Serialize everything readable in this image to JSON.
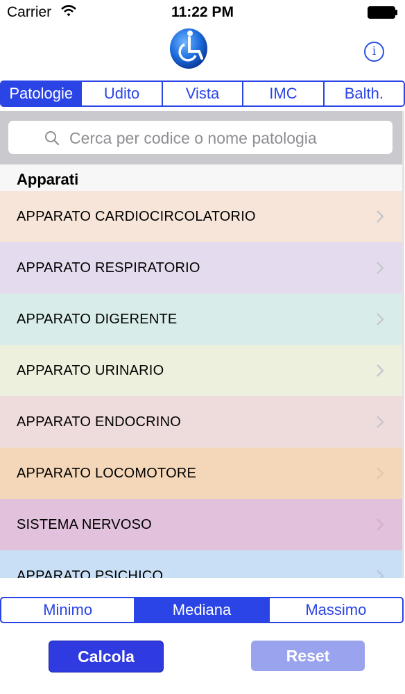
{
  "status_bar": {
    "carrier": "Carrier",
    "time": "11:22 PM"
  },
  "nav": {
    "logo_icon": "wheelchair-logo-icon",
    "info_icon": "info-icon",
    "info_glyph": "i"
  },
  "tabs": [
    {
      "label": "Patologie",
      "active": true
    },
    {
      "label": "Udito",
      "active": false
    },
    {
      "label": "Vista",
      "active": false
    },
    {
      "label": "IMC",
      "active": false
    },
    {
      "label": "Balth.",
      "active": false
    }
  ],
  "search": {
    "placeholder": "Cerca per codice o nome patologia"
  },
  "list": {
    "section_title": "Apparati",
    "items": [
      {
        "label": "APPARATO CARDIOCIRCOLATORIO",
        "color": "#f6e5d8"
      },
      {
        "label": "APPARATO RESPIRATORIO",
        "color": "#e4dcee"
      },
      {
        "label": "APPARATO DIGERENTE",
        "color": "#d8ede9"
      },
      {
        "label": "APPARATO URINARIO",
        "color": "#edf0dd"
      },
      {
        "label": "APPARATO ENDOCRINO",
        "color": "#eedbdc"
      },
      {
        "label": "APPARATO LOCOMOTORE",
        "color": "#f3d7b8"
      },
      {
        "label": "SISTEMA NERVOSO",
        "color": "#e1c1dc"
      },
      {
        "label": "APPARATO PSICHICO",
        "color": "#c9dff5"
      }
    ]
  },
  "segmented": [
    {
      "label": "Minimo",
      "active": false
    },
    {
      "label": "Mediana",
      "active": true
    },
    {
      "label": "Massimo",
      "active": false
    }
  ],
  "buttons": {
    "calcola": "Calcola",
    "reset": "Reset"
  },
  "colors": {
    "accent": "#2a44e6",
    "calcola_bg": "#2f3ae0",
    "reset_bg": "#9aa3ee",
    "search_bg": "#c9c9ce"
  }
}
